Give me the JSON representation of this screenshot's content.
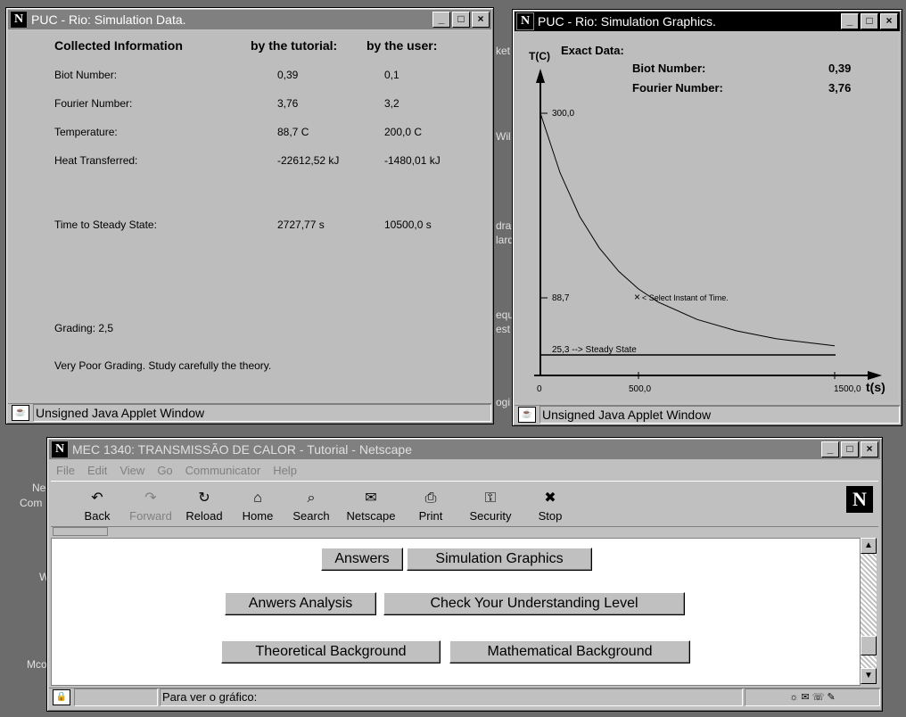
{
  "desktop": {
    "labels": [
      "ket",
      "Wil",
      "dra",
      "lard",
      "equ",
      "est",
      "ogi",
      "Ne",
      "Com",
      "W",
      "Mco"
    ]
  },
  "sim_data_window": {
    "title": "PUC - Rio: Simulation Data.",
    "headers": {
      "info": "Collected Information",
      "tutorial": "by the tutorial:",
      "user": "by the user:"
    },
    "rows": [
      {
        "label": "Biot Number:",
        "tutorial": "0,39",
        "user": "0,1"
      },
      {
        "label": "Fourier Number:",
        "tutorial": "3,76",
        "user": "3,2"
      },
      {
        "label": "Temperature:",
        "tutorial": "88,7 C",
        "user": "200,0 C"
      },
      {
        "label": "Heat Transferred:",
        "tutorial": "-22612,52 kJ",
        "user": "-1480,01 kJ"
      },
      {
        "label": "Time to Steady State:",
        "tutorial": "2727,77 s",
        "user": "10500,0 s"
      }
    ],
    "grading": "Grading: 2,5",
    "comment": "Very Poor Grading. Study carefully the theory.",
    "status": "Unsigned Java Applet Window"
  },
  "sim_graphics_window": {
    "title": "PUC - Rio: Simulation Graphics.",
    "exact_data_label": "Exact Data:",
    "biot_label": "Biot Number:",
    "biot_value": "0,39",
    "fourier_label": "Fourier Number:",
    "fourier_value": "3,76",
    "ylabel": "T(C)",
    "xlabel": "t(s)",
    "tick_300": "300,0",
    "tick_887": "88,7",
    "steady_label": "25,3 --> Steady State",
    "select_label": "< Select Instant of Time.",
    "x0": "0",
    "x500": "500,0",
    "x1500": "1500,0",
    "status": "Unsigned Java Applet Window"
  },
  "chart_data": {
    "type": "line",
    "title": "",
    "xlabel": "t(s)",
    "ylabel": "T(C)",
    "xlim": [
      0,
      1500
    ],
    "ylim": [
      0,
      300
    ],
    "series": [
      {
        "x": [
          0,
          100,
          200,
          300,
          400,
          500,
          600,
          800,
          1000,
          1200,
          1500
        ],
        "y": [
          300,
          232,
          182,
          146,
          119,
          99,
          84,
          64,
          51,
          42,
          34
        ]
      }
    ],
    "annotations": [
      "300,0",
      "88,7",
      "25,3 --> Steady State",
      "< Select Instant of Time."
    ]
  },
  "netscape_window": {
    "title": "MEC 1340: TRANSMISSÃO DE CALOR - Tutorial - Netscape",
    "menu": [
      "File",
      "Edit",
      "View",
      "Go",
      "Communicator",
      "Help"
    ],
    "toolbar": [
      {
        "label": "Back",
        "icon": "back-icon",
        "glyph": "↶"
      },
      {
        "label": "Forward",
        "icon": "forward-icon",
        "glyph": "↷"
      },
      {
        "label": "Reload",
        "icon": "reload-icon",
        "glyph": "↻"
      },
      {
        "label": "Home",
        "icon": "home-icon",
        "glyph": "⌂"
      },
      {
        "label": "Search",
        "icon": "search-icon",
        "glyph": "⌕"
      },
      {
        "label": "Netscape",
        "icon": "netscape-icon",
        "glyph": "✉"
      },
      {
        "label": "Print",
        "icon": "print-icon",
        "glyph": "⎙"
      },
      {
        "label": "Security",
        "icon": "lock-icon",
        "glyph": "⚿"
      },
      {
        "label": "Stop",
        "icon": "stop-icon",
        "glyph": "✖"
      }
    ],
    "buttons": {
      "answers": "Answers",
      "sim_graphics": "Simulation Graphics",
      "answers_analysis": "Anwers Analysis",
      "check_level": "Check Your Understanding Level",
      "theoretical": "Theoretical Background",
      "mathematical": "Mathematical Background"
    },
    "status": "Para ver o gráfico:"
  }
}
